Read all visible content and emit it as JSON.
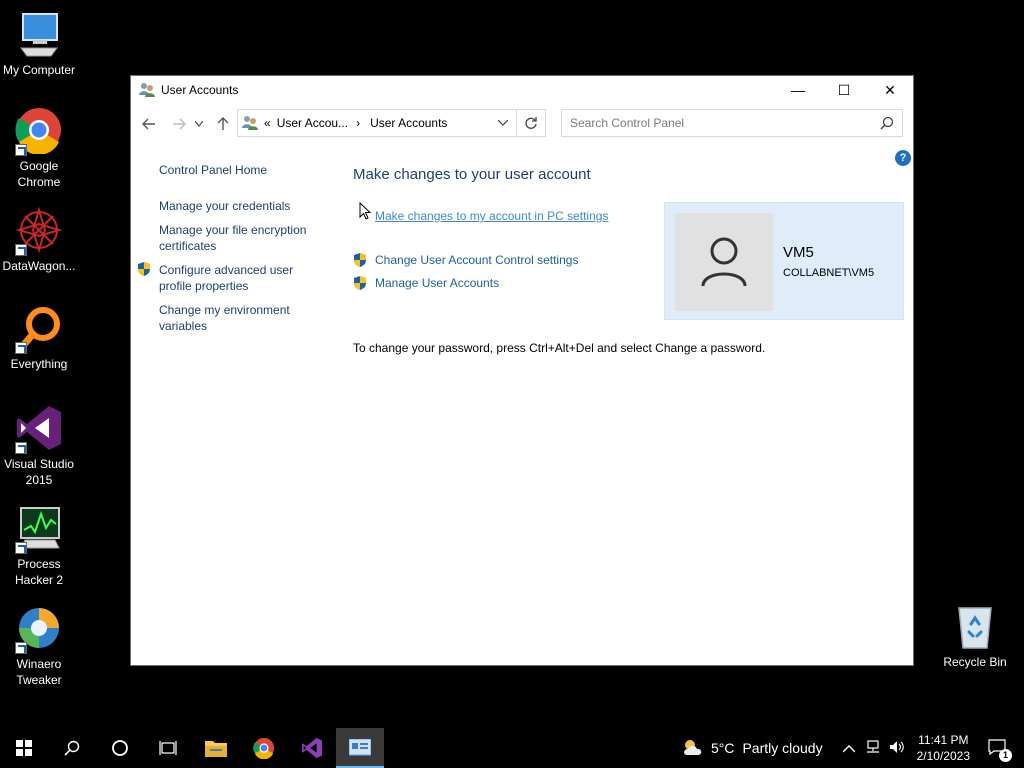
{
  "desktop": {
    "icons": [
      {
        "label": "My Computer"
      },
      {
        "label": "Google Chrome"
      },
      {
        "label": "DataWagon..."
      },
      {
        "label": "Everything"
      },
      {
        "label": "Visual Studio 2015"
      },
      {
        "label": "Process Hacker 2"
      },
      {
        "label": "Winaero Tweaker"
      },
      {
        "label": "Recycle Bin"
      }
    ]
  },
  "window": {
    "title": "User Accounts",
    "controls": {
      "minimize": "—",
      "maximize": "☐",
      "close": "✕"
    },
    "address": {
      "prefix": "«",
      "segment1": "User Accou...",
      "separator": "›",
      "segment2": "User Accounts"
    },
    "search": {
      "placeholder": "Search Control Panel"
    },
    "help": "?",
    "sidebar": {
      "home": "Control Panel Home",
      "credentials": "Manage your credentials",
      "encryption": "Manage your file encryption certificates",
      "advanced": "Configure advanced user profile properties",
      "environment": "Change my environment variables"
    },
    "main": {
      "title": "Make changes to your user account",
      "pc_settings_link": "Make changes to my account in PC settings",
      "uac_link": "Change User Account Control settings",
      "manage_link": "Manage User Accounts",
      "password_note": "To change your password, press Ctrl+Alt+Del and select Change a password."
    },
    "user": {
      "name": "VM5",
      "domain": "COLLABNET\\VM5"
    }
  },
  "taskbar": {
    "weather": {
      "temp": "5°C",
      "condition": "Partly cloudy"
    },
    "clock": {
      "time": "11:41 PM",
      "date": "2/10/2023"
    },
    "notifications": "1"
  },
  "colors": {
    "link": "#1f5fa8",
    "title": "#1e3f73",
    "tile": "#deedf9",
    "accent": "#76b9ed"
  }
}
